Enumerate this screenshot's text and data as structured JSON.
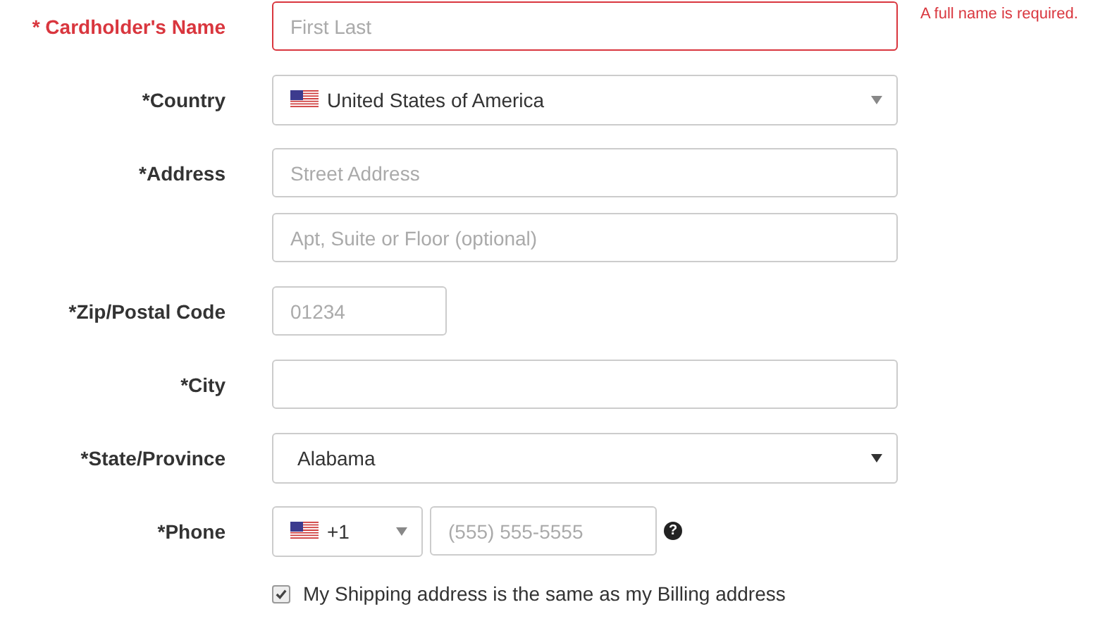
{
  "fields": [
    {
      "kind": "text",
      "label": "* Cardholder's Name",
      "invalid": true,
      "placeholders": [
        "First Last"
      ],
      "error": "A full name is required."
    },
    {
      "kind": "select",
      "label": "*Country",
      "invalid": false,
      "flag": true,
      "value": "United States of America"
    },
    {
      "kind": "text",
      "label": "*Address",
      "invalid": false,
      "placeholders": [
        "Street Address",
        "Apt, Suite or Floor (optional)"
      ]
    },
    {
      "kind": "short",
      "label": "*Zip/Postal Code",
      "invalid": false,
      "placeholders": [
        "01234"
      ]
    },
    {
      "kind": "text",
      "label": "*City",
      "invalid": false
    },
    {
      "kind": "select",
      "label": "*State/Province",
      "invalid": false,
      "flag": false,
      "value": "Alabama"
    },
    {
      "kind": "phone",
      "label": "*Phone",
      "invalid": false,
      "code": "+1",
      "placeholder": "(555) 555-5555",
      "help": "?"
    }
  ],
  "checkbox": {
    "label": "My Shipping address is the same as my Billing address",
    "checked": true
  }
}
